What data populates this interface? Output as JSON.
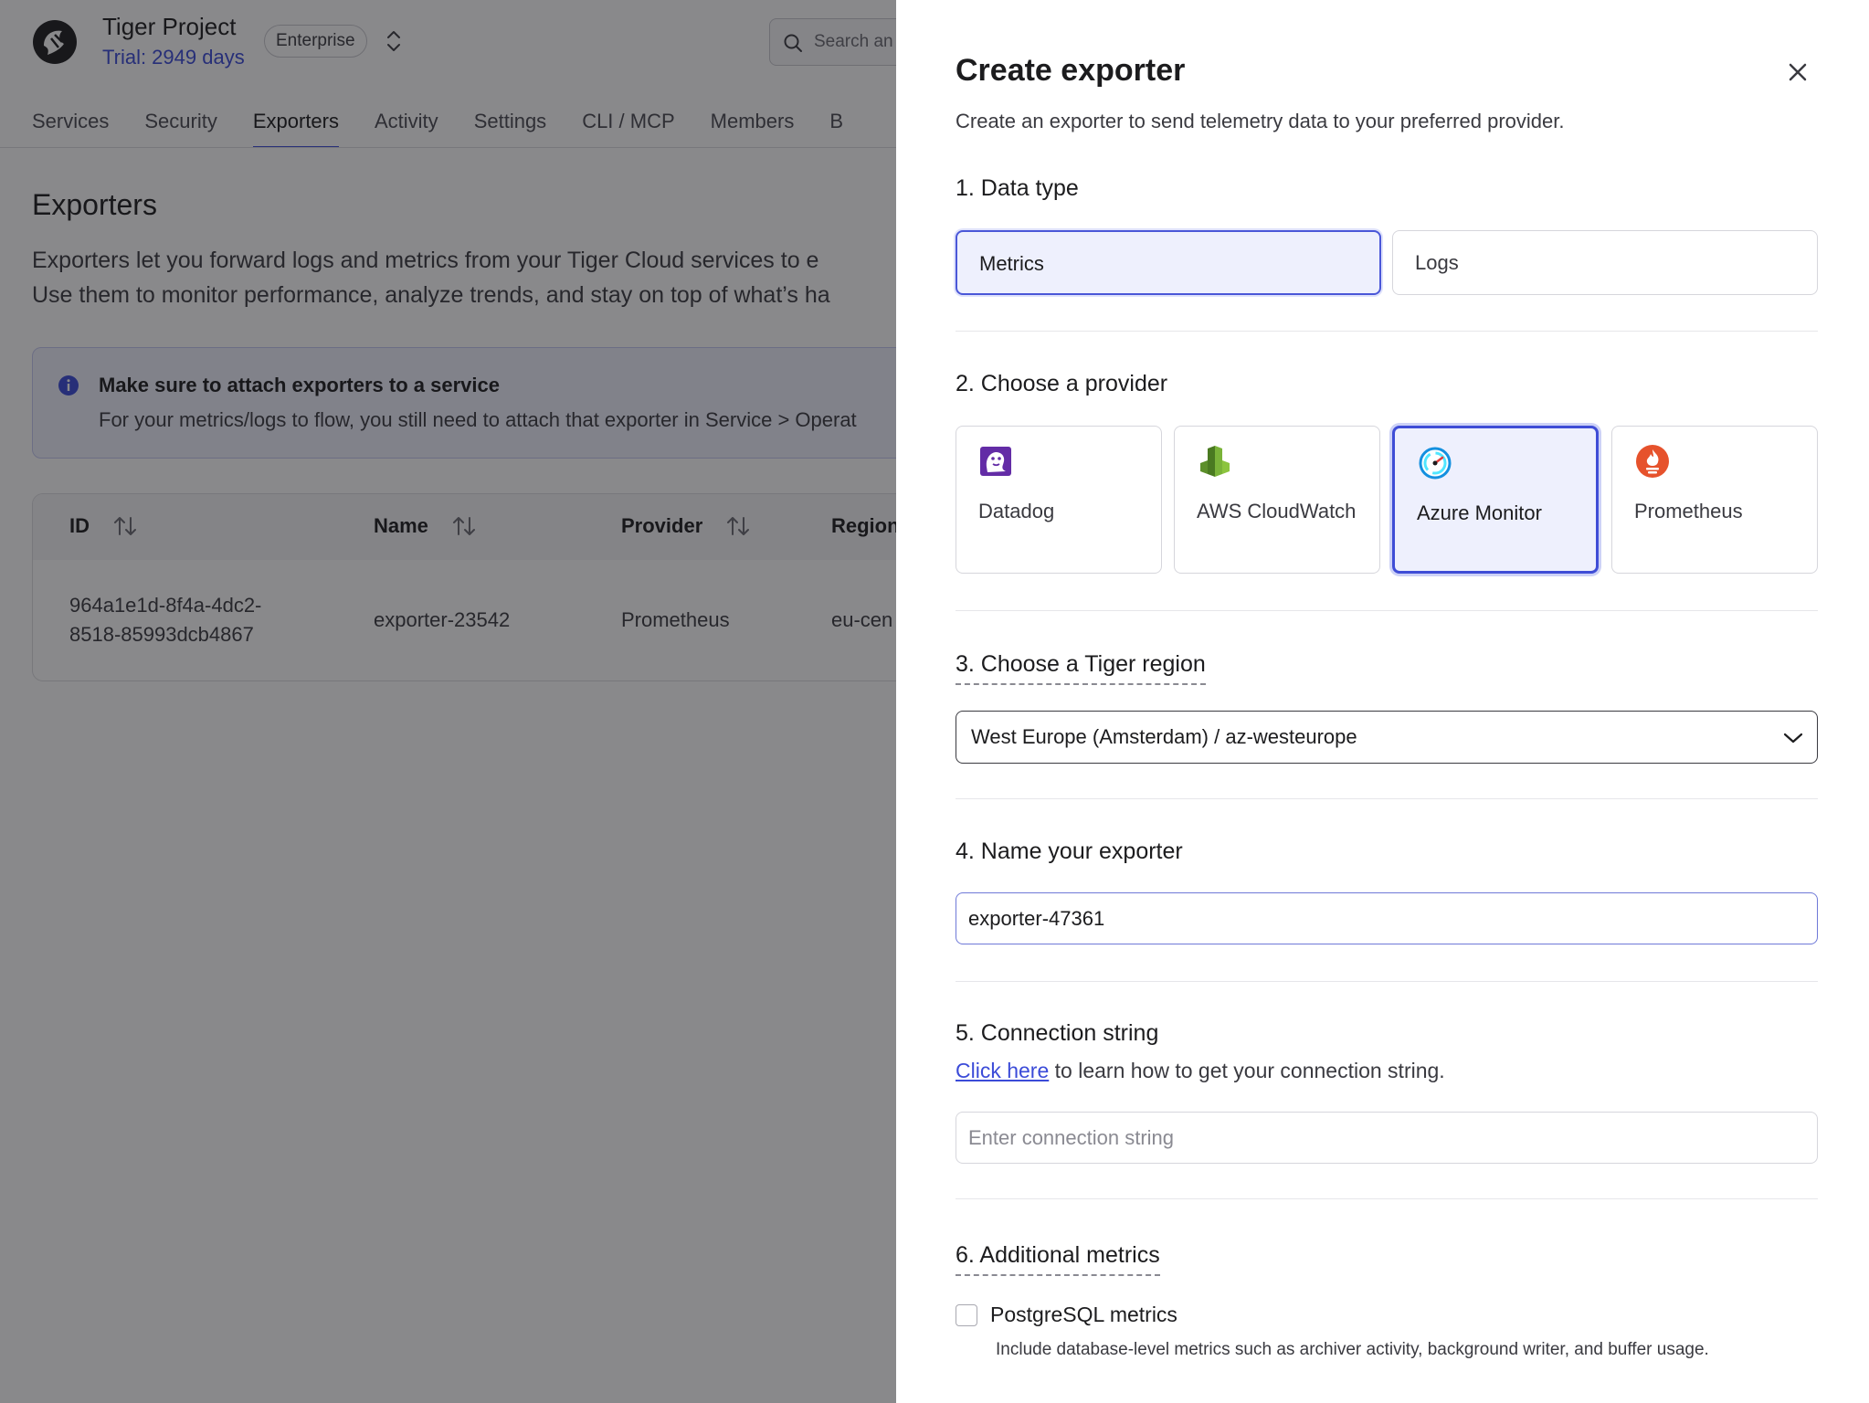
{
  "project": {
    "name": "Tiger Project",
    "trial": "Trial: 2949 days",
    "plan": "Enterprise"
  },
  "search": {
    "placeholder": "Search an"
  },
  "nav": {
    "items": [
      "Services",
      "Security",
      "Exporters",
      "Activity",
      "Settings",
      "CLI / MCP",
      "Members",
      "B"
    ],
    "active": "Exporters"
  },
  "page": {
    "title": "Exporters",
    "desc_line1": "Exporters let you forward logs and metrics from your Tiger Cloud services to e",
    "desc_line2": "Use them to monitor performance, analyze trends, and stay on top of what’s ha"
  },
  "notice": {
    "title": "Make sure to attach exporters to a service",
    "text": "For your metrics/logs to flow, you still need to attach that exporter in Service > Operat"
  },
  "table": {
    "headers": [
      "ID",
      "Name",
      "Provider",
      "Region"
    ],
    "rows": [
      {
        "id_line1": "964a1e1d-8f4a-4dc2-",
        "id_line2": "8518-85993dcb4867",
        "name": "exporter-23542",
        "provider": "Prometheus",
        "region": "eu-cen"
      }
    ]
  },
  "drawer": {
    "title": "Create exporter",
    "subtitle": "Create an exporter to send telemetry data to your preferred provider.",
    "step1": {
      "label": "1. Data type",
      "options": [
        "Metrics",
        "Logs"
      ],
      "selected": "Metrics"
    },
    "step2": {
      "label": "2. Choose a provider",
      "providers": [
        {
          "name": "Datadog",
          "icon": "datadog-icon"
        },
        {
          "name": "AWS CloudWatch",
          "icon": "aws-cloudwatch-icon"
        },
        {
          "name": "Azure Monitor",
          "icon": "azure-monitor-icon"
        },
        {
          "name": "Prometheus",
          "icon": "prometheus-icon"
        }
      ],
      "selected": "Azure Monitor"
    },
    "step3": {
      "label": "3. Choose a Tiger region",
      "value": "West Europe (Amsterdam) / az-westeurope"
    },
    "step4": {
      "label": "4. Name your exporter",
      "value": "exporter-47361"
    },
    "step5": {
      "label": "5. Connection string",
      "link": "Click here",
      "help": " to learn how to get your connection string.",
      "placeholder": "Enter connection string"
    },
    "step6": {
      "label": "6. Additional metrics",
      "checkbox_label": "PostgreSQL metrics",
      "checkbox_checked": false,
      "checkbox_desc": "Include database-level metrics such as archiver activity, background writer, and buffer usage."
    }
  },
  "colors": {
    "accent": "#3b4bd8",
    "selected_bg": "#eef0fd",
    "overlay": "rgba(20,20,24,0.5)"
  }
}
